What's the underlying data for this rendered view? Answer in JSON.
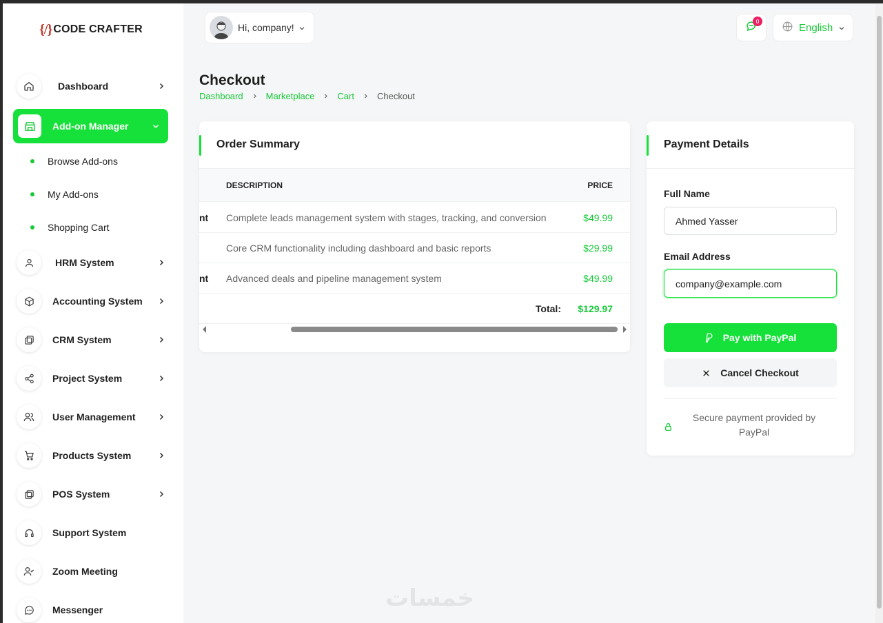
{
  "brand": {
    "mark": "{/}",
    "name": "CODE CRAFTER"
  },
  "header": {
    "greeting": "Hi, company!",
    "notif_count": "0",
    "language": "English"
  },
  "sidebar": {
    "items": [
      {
        "label": "Dashboard",
        "icon": "home-icon"
      },
      {
        "label": "Add-on Manager",
        "icon": "store-icon"
      },
      {
        "label": "HRM System",
        "icon": "user-icon"
      },
      {
        "label": "Accounting System",
        "icon": "box-icon"
      },
      {
        "label": "CRM System",
        "icon": "layers-icon"
      },
      {
        "label": "Project System",
        "icon": "share-icon"
      },
      {
        "label": "User Management",
        "icon": "users-icon"
      },
      {
        "label": "Products System",
        "icon": "cart-icon"
      },
      {
        "label": "POS System",
        "icon": "layers-icon"
      },
      {
        "label": "Support System",
        "icon": "headset-icon"
      },
      {
        "label": "Zoom Meeting",
        "icon": "user-check-icon"
      },
      {
        "label": "Messenger",
        "icon": "chat-icon"
      }
    ],
    "subitems": [
      {
        "label": "Browse Add-ons"
      },
      {
        "label": "My Add-ons"
      },
      {
        "label": "Shopping Cart"
      }
    ]
  },
  "page": {
    "title": "Checkout",
    "breadcrumb": [
      "Dashboard",
      "Marketplace",
      "Cart",
      "Checkout"
    ]
  },
  "order": {
    "title": "Order Summary",
    "headers": {
      "description": "DESCRIPTION",
      "price": "PRICE"
    },
    "rows": [
      {
        "name_cut": "nt",
        "description": "Complete leads management system with stages, tracking, and conversion",
        "price": "$49.99"
      },
      {
        "name_cut": "",
        "description": "Core CRM functionality including dashboard and basic reports",
        "price": "$29.99"
      },
      {
        "name_cut": "nt",
        "description": "Advanced deals and pipeline management system",
        "price": "$49.99"
      }
    ],
    "total_label": "Total:",
    "total_value": "$129.97"
  },
  "payment": {
    "title": "Payment Details",
    "full_name_label": "Full Name",
    "full_name_value": "Ahmed Yasser",
    "email_label": "Email Address",
    "email_value": "company@example.com",
    "pay_label": "Pay with PayPal",
    "cancel_label": "Cancel Checkout",
    "secure_note": "Secure payment provided by PayPal"
  },
  "watermark": "خمسات",
  "colors": {
    "accent": "#16e03a",
    "accent_text": "#16c938",
    "badge": "#ee1e62"
  }
}
